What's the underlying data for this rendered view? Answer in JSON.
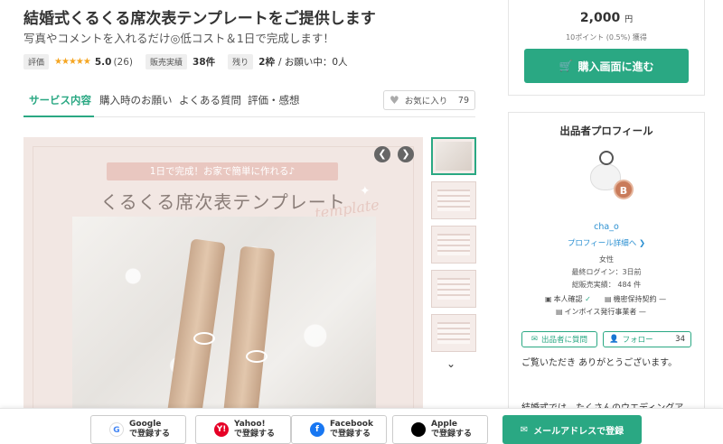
{
  "product": {
    "title": "結婚式くるくる席次表テンプレートをご提供します",
    "subtitle": "写真やコメントを入れるだけ◎低コスト＆1日で完成します！",
    "stats": {
      "rating_label": "評価",
      "stars": "★★★★★",
      "rating": "5.0",
      "reviews": "(26)",
      "sales_label": "販売実績",
      "sales": "38件",
      "remaining_label": "残り",
      "remaining_slots": "2枠",
      "requests": "/ お願い中：0人"
    }
  },
  "tabs": [
    "サービス内容",
    "購入時のお願い",
    "よくある質問",
    "評価・感想"
  ],
  "favorite": {
    "label": "お気に入り",
    "count": "79"
  },
  "image": {
    "banner": "1日で完成！お家で簡単に作れる♪",
    "title": "くるくる席次表テンプレート",
    "script": "template"
  },
  "purchase": {
    "price": "2,000",
    "currency": "円",
    "points": "10ポイント (0.5%) 獲得",
    "buy_label": "購入画面に進む"
  },
  "seller": {
    "heading": "出品者プロフィール",
    "badge": "B",
    "username": "cha_o",
    "profile_link": "プロフィール詳細へ ❯",
    "gender": "女性",
    "last_login": "最終ログイン：3日前",
    "total_sales": "総販売実績： 484 件",
    "identity": "本人確認",
    "nda": "機密保持契約",
    "invoice": "インボイス発行事業者",
    "message_label": "出品者に質問",
    "follow_label": "フォロー",
    "follow_count": "34",
    "greeting": "ご覧いただき ありがとうございます。",
    "description": "結婚式では、たくさんのウエディングア"
  },
  "signup": {
    "google": [
      "Google",
      "で登録する"
    ],
    "yahoo": [
      "Yahoo!",
      "で登録する"
    ],
    "facebook": [
      "Facebook",
      "で登録する"
    ],
    "apple": [
      "Apple",
      "で登録する"
    ],
    "email": "メールアドレスで登録"
  },
  "colors": {
    "accent": "#2aa883",
    "link": "#2a8fd1",
    "stars": "#f5a623"
  }
}
